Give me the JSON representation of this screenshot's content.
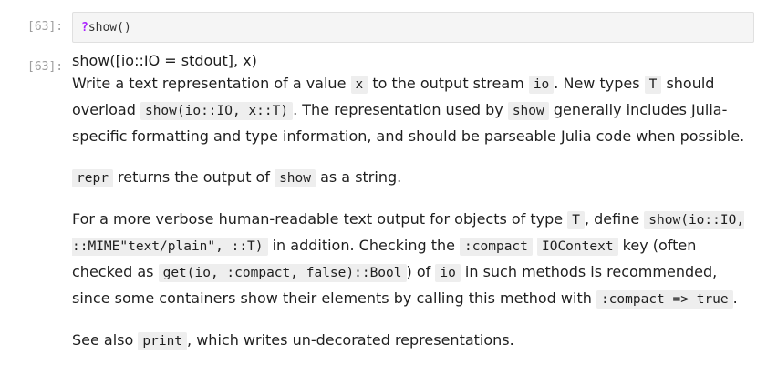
{
  "prompts": {
    "input": "[63]:",
    "output": "[63]:"
  },
  "input_cell": {
    "qmark": "?",
    "code": "show()"
  },
  "doc": {
    "signature": "show([io::IO = stdout], x)",
    "p1": {
      "t1": "Write a text representation of a value ",
      "c1": "x",
      "t2": " to the output stream ",
      "c2": "io",
      "t3": ". New types ",
      "c3": "T",
      "t4": " should overload ",
      "c4": "show(io::IO, x::T)",
      "t5": ". The representation used by ",
      "c5": "show",
      "t6": " generally includes Julia-specific formatting and type information, and should be parseable Julia code when possible."
    },
    "p2": {
      "c1": "repr",
      "t1": " returns the output of ",
      "c2": "show",
      "t2": " as a string."
    },
    "p3": {
      "t1": "For a more verbose human-readable text output for objects of type ",
      "c1": "T",
      "t2": ", define ",
      "c2": "show(io::IO, ::MIME\"text/plain\", ::T)",
      "t3": " in addition. Checking the ",
      "c3": ":compact",
      "t4": " ",
      "c4": "IOContext",
      "t5": " key (often checked as ",
      "c5": "get(io, :compact, false)::Bool",
      "t6": ") of ",
      "c6": "io",
      "t7": " in such methods is recommended, since some containers show their elements by calling this method with ",
      "c7": ":compact => true",
      "t8": "."
    },
    "p4": {
      "t1": "See also ",
      "c1": "print",
      "t2": ", which writes un-decorated representations."
    }
  }
}
